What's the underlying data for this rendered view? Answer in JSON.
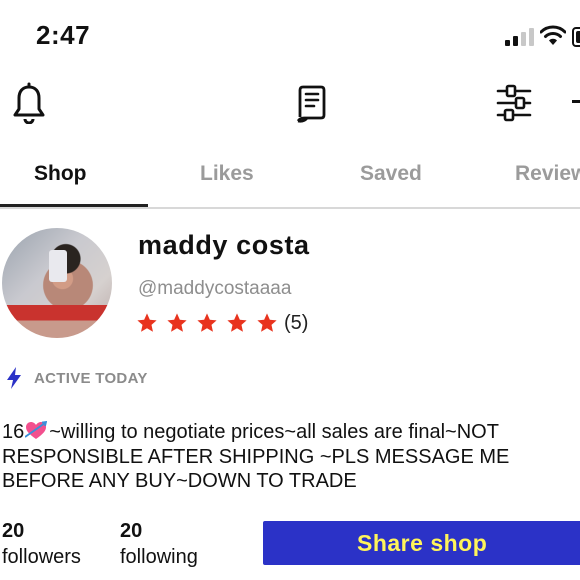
{
  "status_bar": {
    "time": "2:47"
  },
  "toolbar": {
    "bell_icon": "bell-icon",
    "receipt_icon": "receipt-icon",
    "filter_icon": "sliders-icon"
  },
  "tabs": [
    {
      "label": "Shop",
      "active": true
    },
    {
      "label": "Likes",
      "active": false
    },
    {
      "label": "Saved",
      "active": false
    },
    {
      "label": "Reviews",
      "active": false
    }
  ],
  "profile": {
    "name": "maddy costa",
    "handle": "@maddycostaaaa",
    "rating_stars": 5,
    "review_count": "(5)",
    "activity": "ACTIVE TODAY",
    "bio_lines": [
      {
        "before": "16",
        "after": "~willing to negotiate prices~all sales are final~NOT"
      },
      {
        "text": "RESPONSIBLE AFTER SHIPPING ~PLS MESSAGE ME"
      },
      {
        "text": "BEFORE ANY BUY~DOWN TO TRADE"
      }
    ],
    "followers": {
      "count": "20",
      "label": "followers"
    },
    "following": {
      "count": "20",
      "label": "following"
    }
  },
  "share_button": {
    "label": "Share shop"
  },
  "colors": {
    "accent": "#2b32c7",
    "button_text": "#fff45a",
    "star": "#e8331e",
    "bolt": "#2b32c7",
    "muted": "#9b9b9b"
  }
}
